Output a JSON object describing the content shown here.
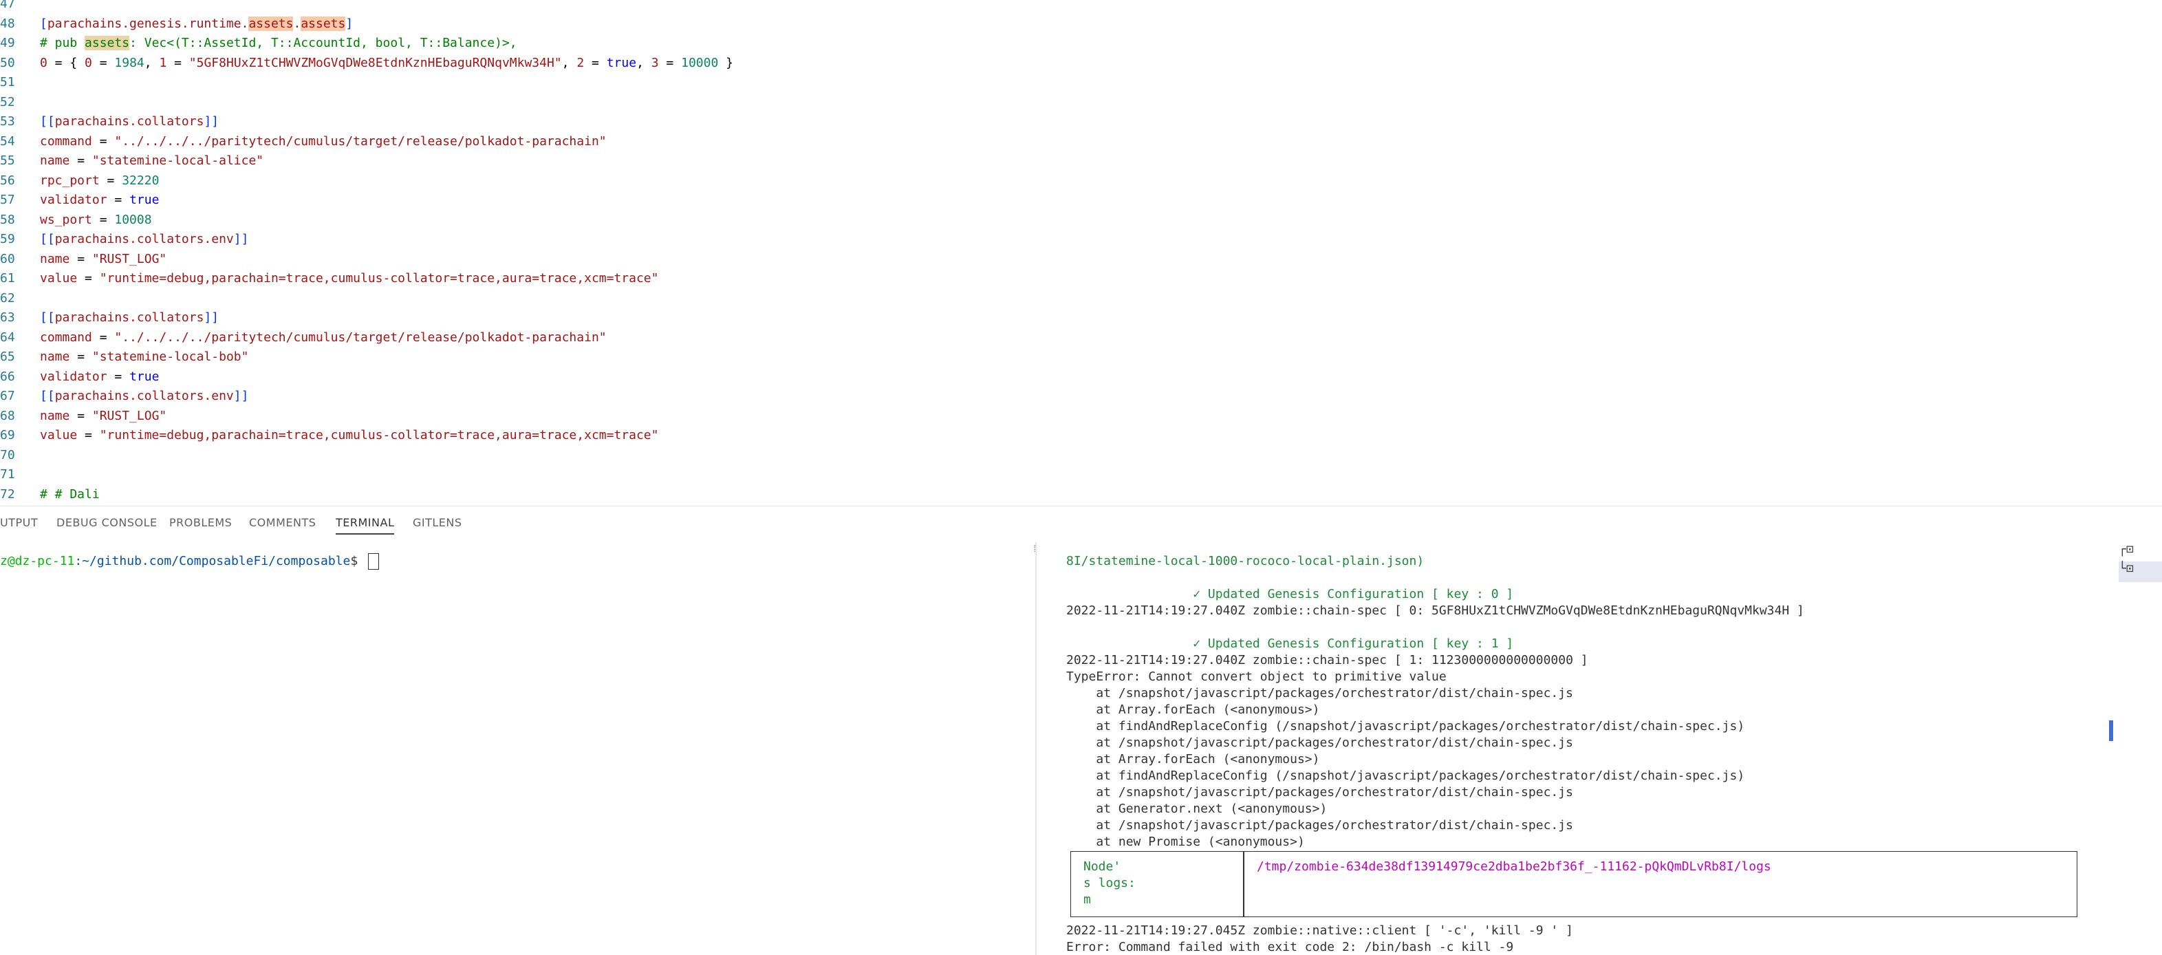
{
  "editor": {
    "lines": [
      {
        "n": "47",
        "parts": []
      },
      {
        "n": "48",
        "parts": [
          {
            "t": "[",
            "c": "t-br"
          },
          {
            "t": "parachains.genesis.runtime.",
            "c": "t-sec"
          },
          {
            "t": "assets",
            "c": "t-sec t-hl"
          },
          {
            "t": ".",
            "c": "t-sec"
          },
          {
            "t": "assets",
            "c": "t-sec t-hl"
          },
          {
            "t": "]",
            "c": "t-br"
          }
        ]
      },
      {
        "n": "49",
        "parts": [
          {
            "t": "# pub ",
            "c": "t-com"
          },
          {
            "t": "assets",
            "c": "t-com t-hl2"
          },
          {
            "t": ": Vec<(T::AssetId, T::AccountId, bool, T::Balance)>,",
            "c": "t-com"
          }
        ]
      },
      {
        "n": "50",
        "parts": [
          {
            "t": "0",
            "c": "t-key"
          },
          {
            "t": " = { ",
            "c": "t-op"
          },
          {
            "t": "0",
            "c": "t-key"
          },
          {
            "t": " = ",
            "c": "t-op"
          },
          {
            "t": "1984",
            "c": "t-num"
          },
          {
            "t": ", ",
            "c": "t-op"
          },
          {
            "t": "1",
            "c": "t-key"
          },
          {
            "t": " = ",
            "c": "t-op"
          },
          {
            "t": "\"5GF8HUxZ1tCHWVZMoGVqDWe8EtdnKznHEbaguRQNqvMkw34H\"",
            "c": "t-str"
          },
          {
            "t": ", ",
            "c": "t-op"
          },
          {
            "t": "2",
            "c": "t-key"
          },
          {
            "t": " = ",
            "c": "t-op"
          },
          {
            "t": "true",
            "c": "t-bool"
          },
          {
            "t": ", ",
            "c": "t-op"
          },
          {
            "t": "3",
            "c": "t-key"
          },
          {
            "t": " = ",
            "c": "t-op"
          },
          {
            "t": "10000",
            "c": "t-num"
          },
          {
            "t": " }",
            "c": "t-op"
          }
        ]
      },
      {
        "n": "51",
        "parts": []
      },
      {
        "n": "52",
        "parts": []
      },
      {
        "n": "53",
        "parts": [
          {
            "t": "[[",
            "c": "t-br"
          },
          {
            "t": "parachains.collators",
            "c": "t-sec"
          },
          {
            "t": "]]",
            "c": "t-br"
          }
        ]
      },
      {
        "n": "54",
        "parts": [
          {
            "t": "command",
            "c": "t-key"
          },
          {
            "t": " = ",
            "c": "t-op"
          },
          {
            "t": "\"../../../../paritytech/cumulus/target/release/polkadot-parachain\"",
            "c": "t-str"
          }
        ]
      },
      {
        "n": "55",
        "parts": [
          {
            "t": "name",
            "c": "t-key"
          },
          {
            "t": " = ",
            "c": "t-op"
          },
          {
            "t": "\"statemine-local-alice\"",
            "c": "t-str"
          }
        ]
      },
      {
        "n": "56",
        "parts": [
          {
            "t": "rpc_port",
            "c": "t-key"
          },
          {
            "t": " = ",
            "c": "t-op"
          },
          {
            "t": "32220",
            "c": "t-num"
          }
        ]
      },
      {
        "n": "57",
        "parts": [
          {
            "t": "validator",
            "c": "t-key"
          },
          {
            "t": " = ",
            "c": "t-op"
          },
          {
            "t": "true",
            "c": "t-bool"
          }
        ]
      },
      {
        "n": "58",
        "parts": [
          {
            "t": "ws_port",
            "c": "t-key"
          },
          {
            "t": " = ",
            "c": "t-op"
          },
          {
            "t": "10008",
            "c": "t-num"
          }
        ]
      },
      {
        "n": "59",
        "parts": [
          {
            "t": "[[",
            "c": "t-br"
          },
          {
            "t": "parachains.collators.env",
            "c": "t-sec"
          },
          {
            "t": "]]",
            "c": "t-br"
          }
        ]
      },
      {
        "n": "60",
        "parts": [
          {
            "t": "name",
            "c": "t-key"
          },
          {
            "t": " = ",
            "c": "t-op"
          },
          {
            "t": "\"RUST_LOG\"",
            "c": "t-str"
          }
        ]
      },
      {
        "n": "61",
        "parts": [
          {
            "t": "value",
            "c": "t-key"
          },
          {
            "t": " = ",
            "c": "t-op"
          },
          {
            "t": "\"runtime=debug,parachain=trace,cumulus-collator=trace,aura=trace,xcm=trace\"",
            "c": "t-str"
          }
        ]
      },
      {
        "n": "62",
        "parts": []
      },
      {
        "n": "63",
        "parts": [
          {
            "t": "[[",
            "c": "t-br"
          },
          {
            "t": "parachains.collators",
            "c": "t-sec"
          },
          {
            "t": "]]",
            "c": "t-br"
          }
        ]
      },
      {
        "n": "64",
        "parts": [
          {
            "t": "command",
            "c": "t-key"
          },
          {
            "t": " = ",
            "c": "t-op"
          },
          {
            "t": "\"../../../../paritytech/cumulus/target/release/polkadot-parachain\"",
            "c": "t-str"
          }
        ]
      },
      {
        "n": "65",
        "parts": [
          {
            "t": "name",
            "c": "t-key"
          },
          {
            "t": " = ",
            "c": "t-op"
          },
          {
            "t": "\"statemine-local-bob\"",
            "c": "t-str"
          }
        ]
      },
      {
        "n": "66",
        "parts": [
          {
            "t": "validator",
            "c": "t-key"
          },
          {
            "t": " = ",
            "c": "t-op"
          },
          {
            "t": "true",
            "c": "t-bool"
          }
        ]
      },
      {
        "n": "67",
        "parts": [
          {
            "t": "[[",
            "c": "t-br"
          },
          {
            "t": "parachains.collators.env",
            "c": "t-sec"
          },
          {
            "t": "]]",
            "c": "t-br"
          }
        ]
      },
      {
        "n": "68",
        "parts": [
          {
            "t": "name",
            "c": "t-key"
          },
          {
            "t": " = ",
            "c": "t-op"
          },
          {
            "t": "\"RUST_LOG\"",
            "c": "t-str"
          }
        ]
      },
      {
        "n": "69",
        "parts": [
          {
            "t": "value",
            "c": "t-key"
          },
          {
            "t": " = ",
            "c": "t-op"
          },
          {
            "t": "\"runtime=debug,parachain=trace,cumulus-collator=trace,aura=trace,xcm=trace\"",
            "c": "t-str"
          }
        ]
      },
      {
        "n": "70",
        "parts": []
      },
      {
        "n": "71",
        "parts": []
      },
      {
        "n": "72",
        "parts": [
          {
            "t": "# # Dali",
            "c": "t-com"
          }
        ]
      }
    ]
  },
  "panel": {
    "tabs": [
      {
        "id": "output",
        "label": "UTPUT",
        "active": false
      },
      {
        "id": "debug-console",
        "label": "DEBUG CONSOLE",
        "active": false
      },
      {
        "id": "problems",
        "label": "PROBLEMS",
        "active": false
      },
      {
        "id": "comments",
        "label": "COMMENTS",
        "active": false
      },
      {
        "id": "terminal",
        "label": "TERMINAL",
        "active": true
      },
      {
        "id": "gitlens",
        "label": "GITLENS",
        "active": false
      }
    ],
    "prompt": {
      "user": "z@dz-pc-11",
      "path": ":~/github.com/ComposableFi/composable",
      "sign": "$ "
    },
    "split_handle": "⁞",
    "right_lines": [
      {
        "text": "8I/statemine-local-1000-rococo-local-plain.json)",
        "cls": "path"
      },
      {
        "text": "",
        "cls": ""
      },
      {
        "text": "                 ✓ Updated Genesis Configuration [ key : 0 ]",
        "cls": "green"
      },
      {
        "text": "2022-11-21T14:19:27.040Z zombie::chain-spec [ 0: 5GF8HUxZ1tCHWVZMoGVqDWe8EtdnKznHEbaguRQNqvMkw34H ]",
        "cls": ""
      },
      {
        "text": "",
        "cls": ""
      },
      {
        "text": "                 ✓ Updated Genesis Configuration [ key : 1 ]",
        "cls": "green"
      },
      {
        "text": "2022-11-21T14:19:27.040Z zombie::chain-spec [ 1: 1123000000000000000 ]",
        "cls": ""
      },
      {
        "text": "TypeError: Cannot convert object to primitive value",
        "cls": ""
      },
      {
        "text": "    at /snapshot/javascript/packages/orchestrator/dist/chain-spec.js",
        "cls": ""
      },
      {
        "text": "    at Array.forEach (<anonymous>)",
        "cls": ""
      },
      {
        "text": "    at findAndReplaceConfig (/snapshot/javascript/packages/orchestrator/dist/chain-spec.js)",
        "cls": ""
      },
      {
        "text": "    at /snapshot/javascript/packages/orchestrator/dist/chain-spec.js",
        "cls": ""
      },
      {
        "text": "    at Array.forEach (<anonymous>)",
        "cls": ""
      },
      {
        "text": "    at findAndReplaceConfig (/snapshot/javascript/packages/orchestrator/dist/chain-spec.js)",
        "cls": ""
      },
      {
        "text": "    at /snapshot/javascript/packages/orchestrator/dist/chain-spec.js",
        "cls": ""
      },
      {
        "text": "    at Generator.next (<anonymous>)",
        "cls": ""
      },
      {
        "text": "    at /snapshot/javascript/packages/orchestrator/dist/chain-spec.js",
        "cls": ""
      },
      {
        "text": "    at new Promise (<anonymous>)",
        "cls": ""
      }
    ],
    "node_box": {
      "label": "Node'\ns logs:\nm",
      "value": "/tmp/zombie-634de38df13914979ce2dba1be2bf36f_-11162-pQkQmDLvRb8I/logs"
    },
    "tail_lines": [
      {
        "text": "2022-11-21T14:19:27.045Z zombie::native::client [ '-c', 'kill -9 ' ]",
        "cls": ""
      },
      {
        "text": "Error: Command failed with exit code 2: /bin/bash -c kill -9",
        "cls": ""
      }
    ],
    "side_tools": [
      {
        "id": "split",
        "label": "┌⊡",
        "selected": false
      },
      {
        "id": "kill",
        "label": "└⊡",
        "selected": true
      }
    ]
  }
}
